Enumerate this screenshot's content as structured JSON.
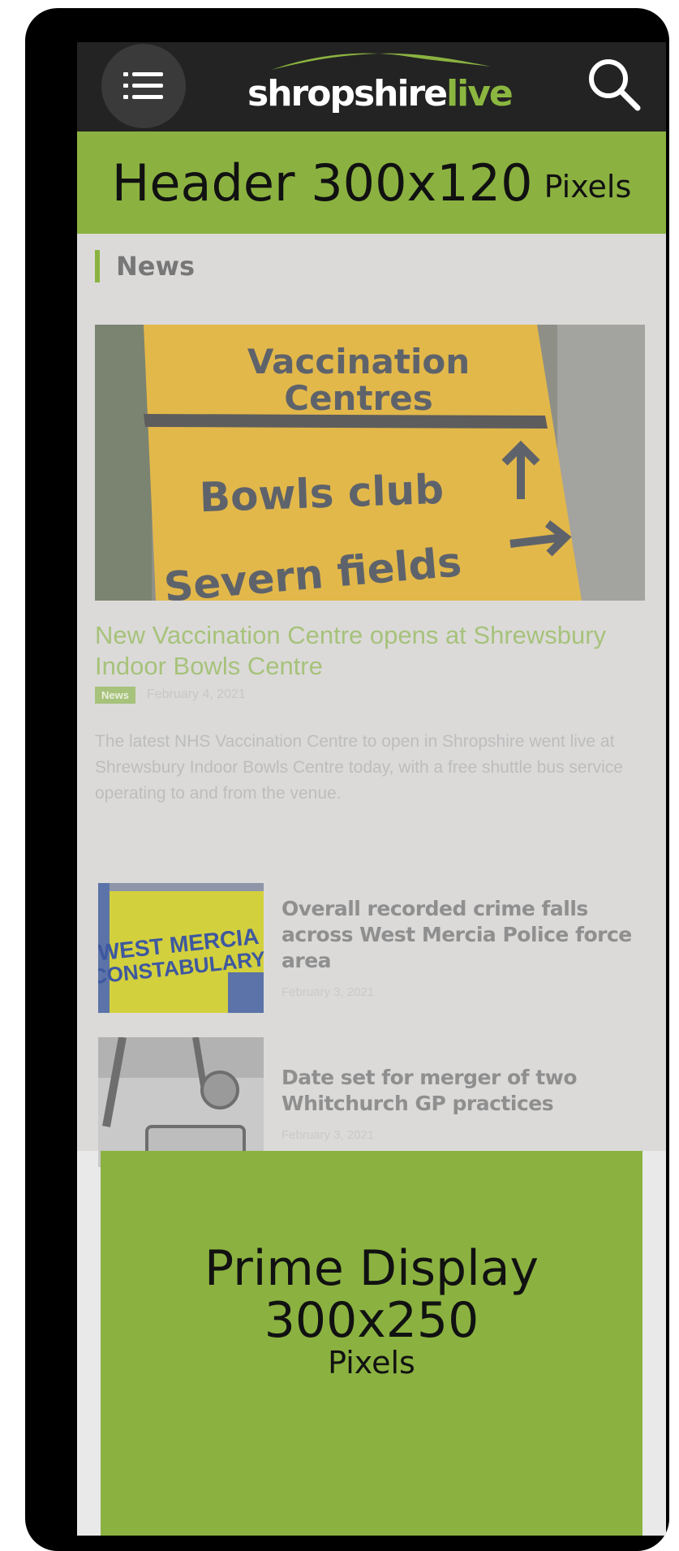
{
  "app": {
    "logo": {
      "part1": "shropshire",
      "part2": "live"
    },
    "icons": {
      "menu": "list-menu-icon",
      "search": "search-icon"
    },
    "colors": {
      "brand_green": "#8bb240",
      "topbar": "#232323",
      "frame": "#000000"
    }
  },
  "header_ad": {
    "label": "Header 300x120",
    "unit": "Pixels"
  },
  "news": {
    "section_title": "News",
    "featured": {
      "image_sign": {
        "line1": "Vaccination",
        "line2": "Centres",
        "line3": "Bowls club",
        "line4": "Severn fields"
      },
      "title": "New Vaccination Centre opens at Shrewsbury Indoor Bowls Centre",
      "tag": "News",
      "date": "February 4, 2021",
      "excerpt": "The latest NHS Vaccination Centre to open in Shropshire went live at Shrewsbury Indoor Bowls Centre today, with a free shuttle bus service operating to and from the venue."
    },
    "articles": [
      {
        "thumb_text1": "WEST MERCIA",
        "thumb_text2": "CONSTABULARY",
        "title": "Overall recorded crime falls across West Mercia Police force area",
        "date": "February 3, 2021"
      },
      {
        "title": "Date set for merger of two Whitchurch GP practices",
        "date": "February 3, 2021"
      }
    ]
  },
  "prime_ad": {
    "line1": "Prime Display",
    "line2": "300x250",
    "line3": "Pixels"
  }
}
